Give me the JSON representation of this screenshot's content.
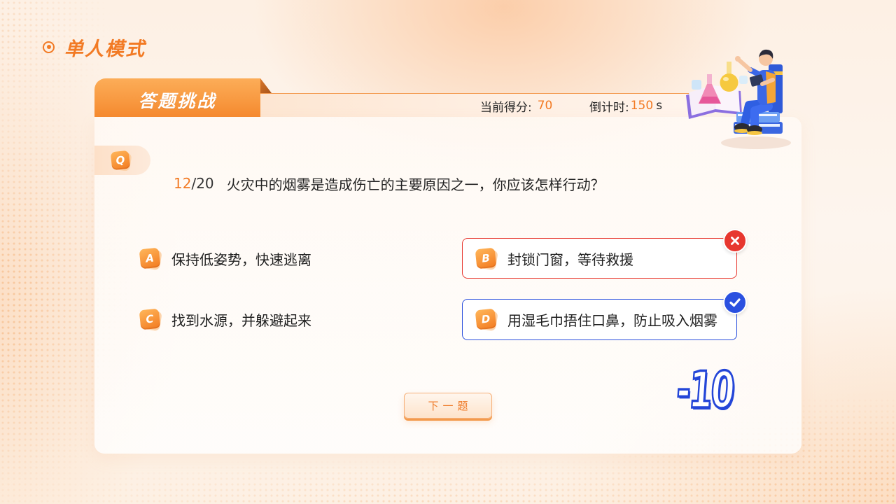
{
  "mode": {
    "title": "单人模式",
    "icon": "target-dot-icon"
  },
  "header": {
    "tab_label": "答题挑战",
    "score_label": "当前得分:",
    "score_value": "70",
    "timer_label": "倒计时:",
    "timer_value": "150",
    "timer_unit": "s"
  },
  "question": {
    "badge": "Q",
    "current": "12",
    "total": "/20",
    "text": "火灾中的烟雾是造成伤亡的主要原因之一，你应该怎样行动？"
  },
  "options": [
    {
      "letter": "A",
      "text": "保持低姿势，快速逃离",
      "border": null,
      "status_icon": null
    },
    {
      "letter": "B",
      "text": "封锁门窗，等待救援",
      "border": "#e7372f",
      "status_icon": "wrong-x-icon"
    },
    {
      "letter": "C",
      "text": "找到水源，并躲避起来",
      "border": null,
      "status_icon": null
    },
    {
      "letter": "D",
      "text": "用湿毛巾捂住口鼻，防止吸入烟雾",
      "border": "#2a4fdc",
      "status_icon": "correct-check-icon"
    }
  ],
  "penalty": "-10",
  "next_button": {
    "label": "下一题"
  },
  "illustration": {
    "icon": "scientist-reading-illustration"
  },
  "colors": {
    "accent": "#f27a24",
    "wrong": "#e7372f",
    "correct": "#2a4fdc",
    "penalty": "#2446d8",
    "text": "#1f1f1f"
  }
}
